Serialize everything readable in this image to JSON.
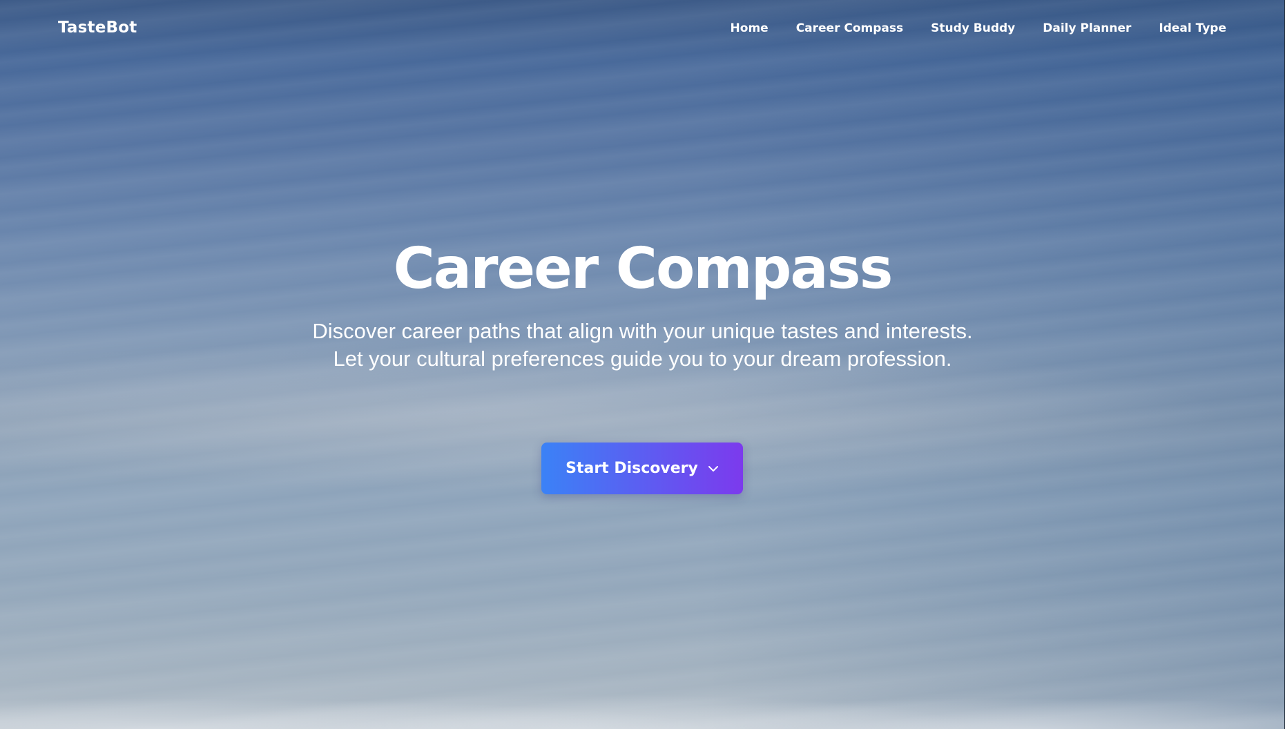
{
  "nav": {
    "brand": "TasteBot",
    "links": [
      "Home",
      "Career Compass",
      "Study Buddy",
      "Daily Planner",
      "Ideal Type"
    ]
  },
  "hero": {
    "title": "Career Compass",
    "subtitle": "Discover career paths that align with your unique tastes and interests. Let your cultural preferences guide you to your dream profession.",
    "cta_label": "Start Discovery",
    "cta_icon": "chevron-down-icon"
  },
  "colors": {
    "cta_gradient_start": "#3b82f6",
    "cta_gradient_end": "#7c3aed",
    "text": "#ffffff"
  }
}
